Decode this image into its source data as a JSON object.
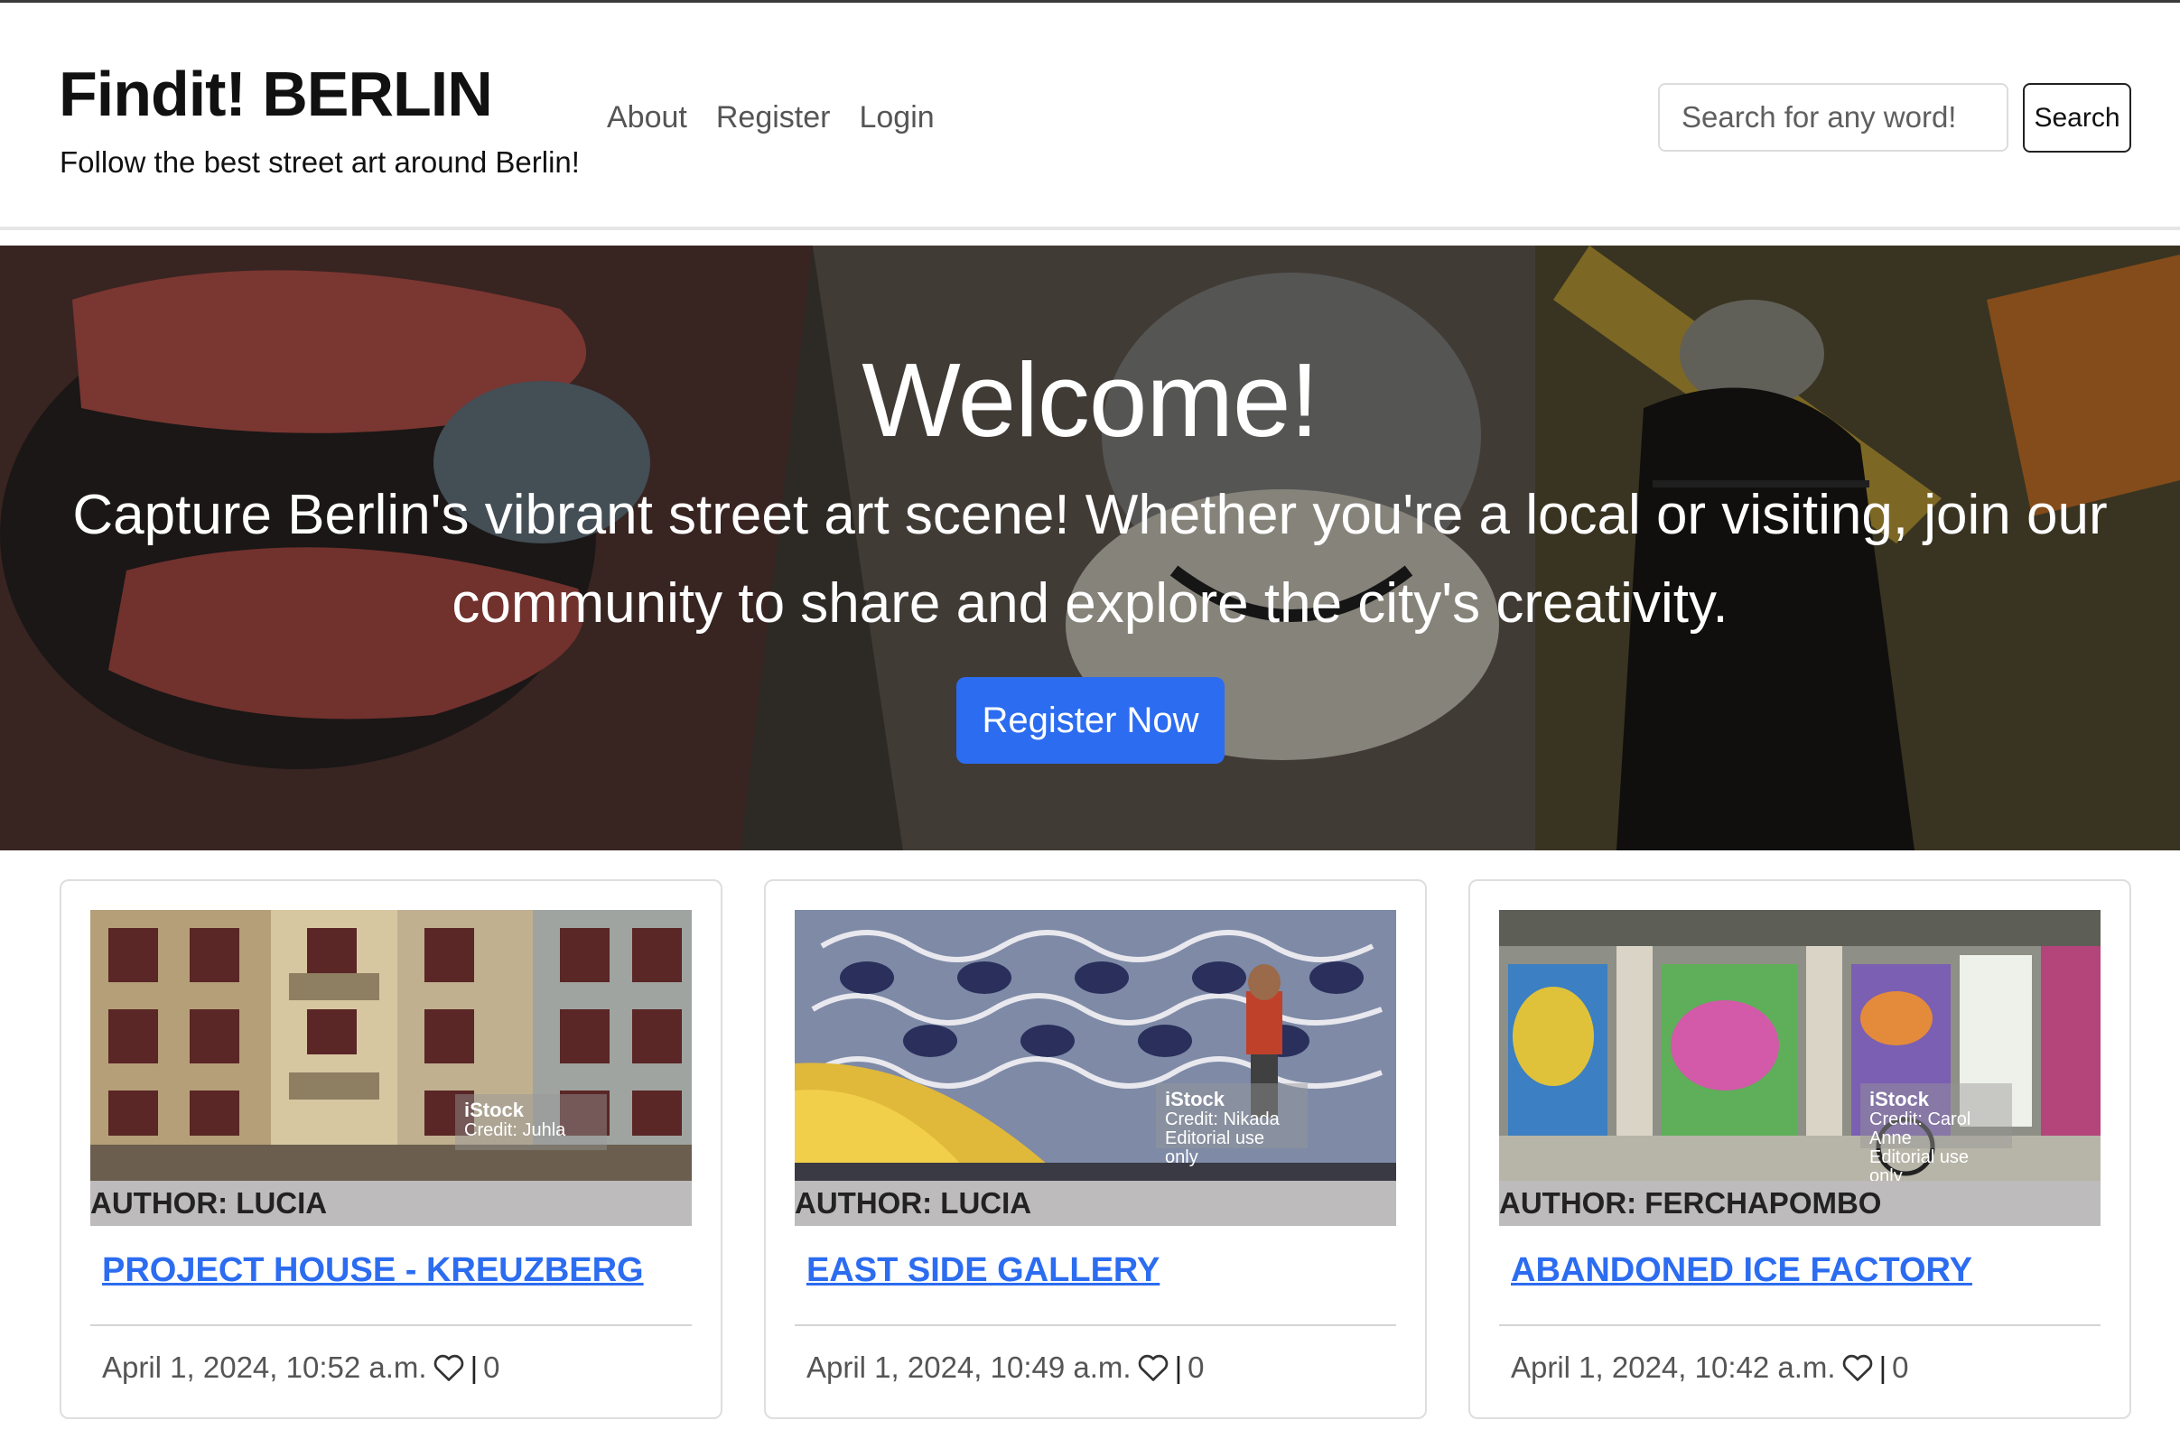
{
  "header": {
    "brand_title": "Findit! BERLIN",
    "tagline": "Follow the best street art around Berlin!",
    "nav": [
      {
        "label": "About"
      },
      {
        "label": "Register"
      },
      {
        "label": "Login"
      }
    ],
    "search": {
      "placeholder": "Search for any word!",
      "button_label": "Search"
    }
  },
  "hero": {
    "title": "Welcome!",
    "subtitle": "Capture Berlin's vibrant street art scene! Whether you're a local or visiting, join our community to share and explore the city's creativity.",
    "button_label": "Register Now",
    "accent_color": "#2c6cf0"
  },
  "posts": [
    {
      "author": "AUTHOR: LUCIA",
      "title": "PROJECT HOUSE - KREUZBERG",
      "date": "April 1, 2024, 10:52 a.m.",
      "likes": "0",
      "image_icon": "building-facade-image",
      "watermark": {
        "brand": "iStock",
        "credit": "Credit: Juhla"
      }
    },
    {
      "author": "AUTHOR: LUCIA",
      "title": "EAST SIDE GALLERY",
      "date": "April 1, 2024, 10:49 a.m.",
      "likes": "0",
      "image_icon": "mural-saxophonist-image",
      "watermark": {
        "brand": "iStock",
        "credit": "Credit: Nikada",
        "note": "Editorial use only"
      }
    },
    {
      "author": "AUTHOR: FERCHAPOMBO",
      "title": "ABANDONED ICE FACTORY",
      "date": "April 1, 2024, 10:42 a.m.",
      "likes": "0",
      "image_icon": "graffiti-factory-image",
      "watermark": {
        "brand": "iStock",
        "credit": "Credit: Carol Anne",
        "note": "Editorial use only"
      }
    }
  ]
}
